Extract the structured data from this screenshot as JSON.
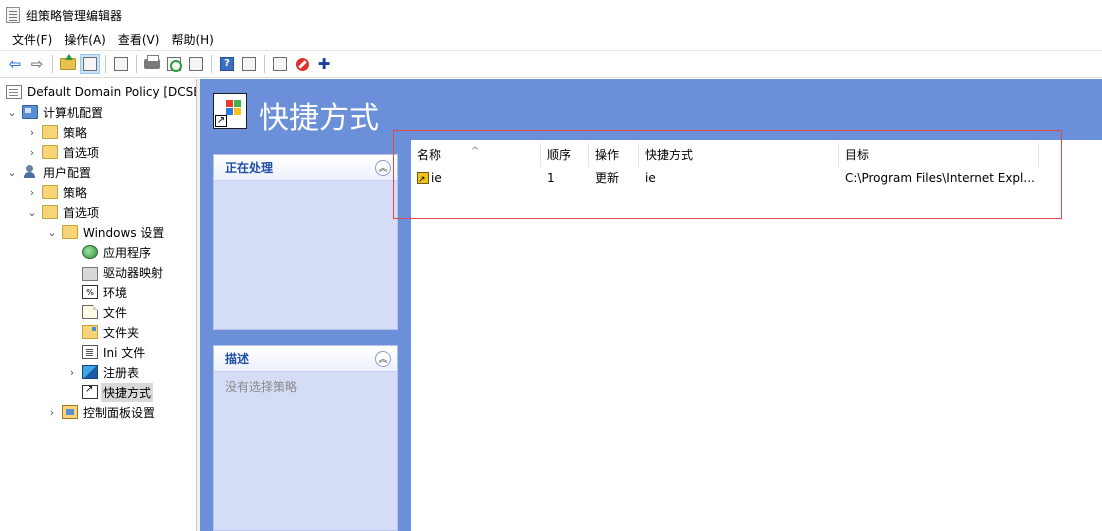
{
  "window": {
    "title": "组策略管理编辑器"
  },
  "menubar": {
    "items": [
      "文件(F)",
      "操作(A)",
      "查看(V)",
      "帮助(H)"
    ]
  },
  "toolbar": {
    "buttons": [
      "back-icon",
      "forward-icon",
      "up-icon",
      "show-hide-tree-icon",
      "properties-icon",
      "print-icon",
      "refresh-icon",
      "export-icon",
      "help-icon",
      "action-pane-icon",
      "new-icon",
      "stop-icon",
      "add-icon"
    ]
  },
  "tree": {
    "items": [
      {
        "label": "Default Domain Policy [DCSE",
        "icon": "policy-doc-icon"
      },
      {
        "label": "计算机配置",
        "icon": "computer-icon"
      },
      {
        "label": "策略",
        "icon": "folder-icon"
      },
      {
        "label": "首选项",
        "icon": "folder-icon"
      },
      {
        "label": "用户配置",
        "icon": "user-icon"
      },
      {
        "label": "策略",
        "icon": "folder-icon"
      },
      {
        "label": "首选项",
        "icon": "folder-icon"
      },
      {
        "label": "Windows 设置",
        "icon": "folder-icon"
      },
      {
        "label": "应用程序",
        "icon": "globe-icon"
      },
      {
        "label": "驱动器映射",
        "icon": "drive-icon"
      },
      {
        "label": "环境",
        "icon": "environment-icon"
      },
      {
        "label": "文件",
        "icon": "file-icon"
      },
      {
        "label": "文件夹",
        "icon": "folder-icon"
      },
      {
        "label": "Ini 文件",
        "icon": "ini-file-icon"
      },
      {
        "label": "注册表",
        "icon": "registry-icon"
      },
      {
        "label": "快捷方式",
        "icon": "shortcut-icon",
        "selected": true
      },
      {
        "label": "控制面板设置",
        "icon": "control-panel-icon"
      }
    ]
  },
  "content": {
    "header_title": "快捷方式",
    "accent_color": "#6b8fd8",
    "panels": {
      "processing": {
        "title": "正在处理",
        "body": ""
      },
      "description": {
        "title": "描述",
        "body": "没有选择策略"
      }
    }
  },
  "list": {
    "columns": [
      "名称",
      "顺序",
      "操作",
      "快捷方式",
      "目标"
    ],
    "rows": [
      {
        "name": "ie",
        "order": "1",
        "action": "更新",
        "shortcut": "ie",
        "target": "C:\\Program Files\\Internet Expl..."
      }
    ]
  }
}
